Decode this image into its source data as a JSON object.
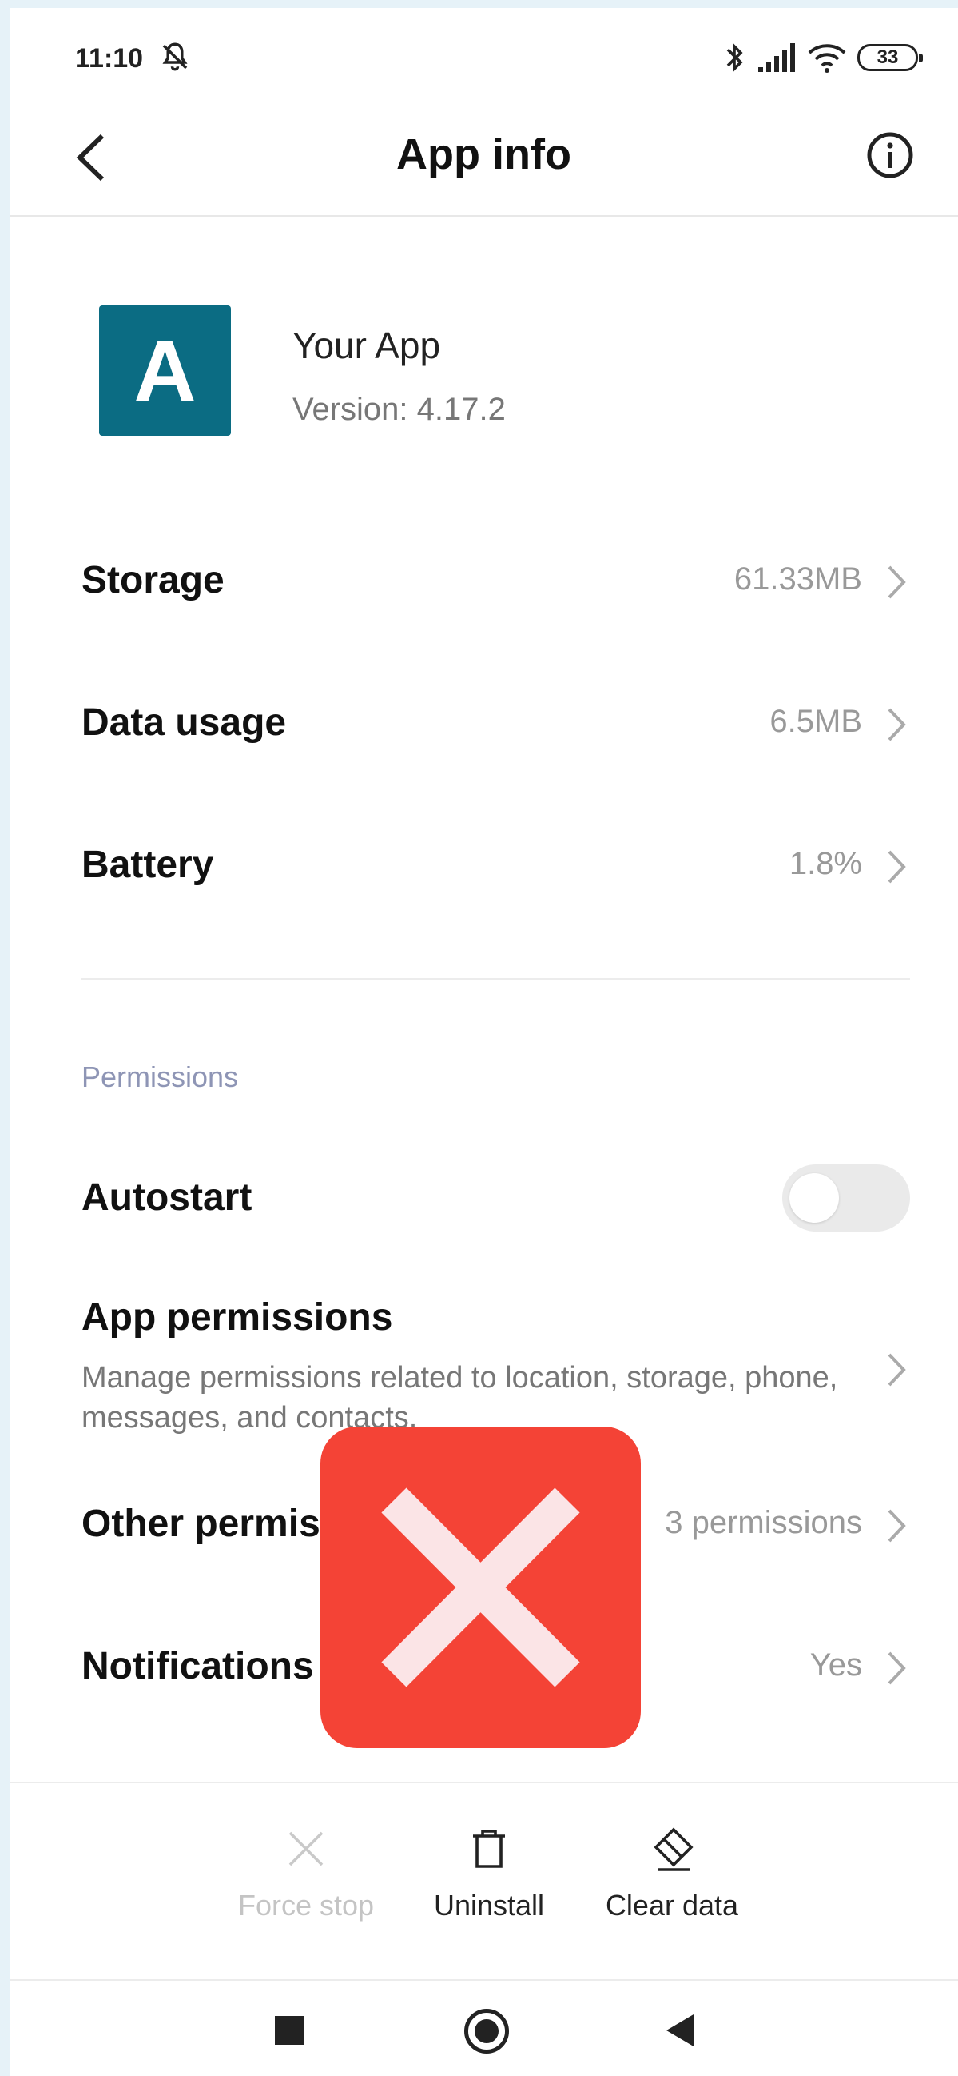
{
  "status_bar": {
    "time": "11:10",
    "battery_level": "33",
    "icons": [
      "notifications-muted-icon",
      "bluetooth-icon",
      "signal-icon",
      "wifi-icon",
      "battery-icon"
    ]
  },
  "app_bar": {
    "title": "App info",
    "back_icon": "chevron-left-icon",
    "info_icon": "info-icon"
  },
  "app": {
    "icon_letter": "A",
    "icon_color": "#0b6c83",
    "name": "Your App",
    "version": "Version: 4.17.2"
  },
  "rows": [
    {
      "title": "Storage",
      "value": "61.33MB"
    },
    {
      "title": "Data usage",
      "value": "6.5MB"
    },
    {
      "title": "Battery",
      "value": "1.8%"
    }
  ],
  "permissions": {
    "section_title": "Permissions",
    "autostart": {
      "title": "Autostart",
      "enabled": false
    },
    "app_permissions": {
      "title": "App permissions",
      "description": "Manage permissions related to location, storage, phone, messages, and contacts."
    },
    "other_permissions": {
      "title": "Other permis",
      "value": "3 permissions"
    },
    "notifications": {
      "title": "Notifications",
      "value": "Yes"
    }
  },
  "overlay": {
    "icon": "error-x-icon",
    "color": "#f44336"
  },
  "actions": {
    "force_stop": {
      "label": "Force stop",
      "enabled": false
    },
    "uninstall": {
      "label": "Uninstall",
      "enabled": true
    },
    "clear_data": {
      "label": "Clear data",
      "enabled": true
    }
  },
  "nav_bar": {
    "icons": [
      "recents-square-icon",
      "home-circle-icon",
      "back-triangle-icon"
    ]
  }
}
